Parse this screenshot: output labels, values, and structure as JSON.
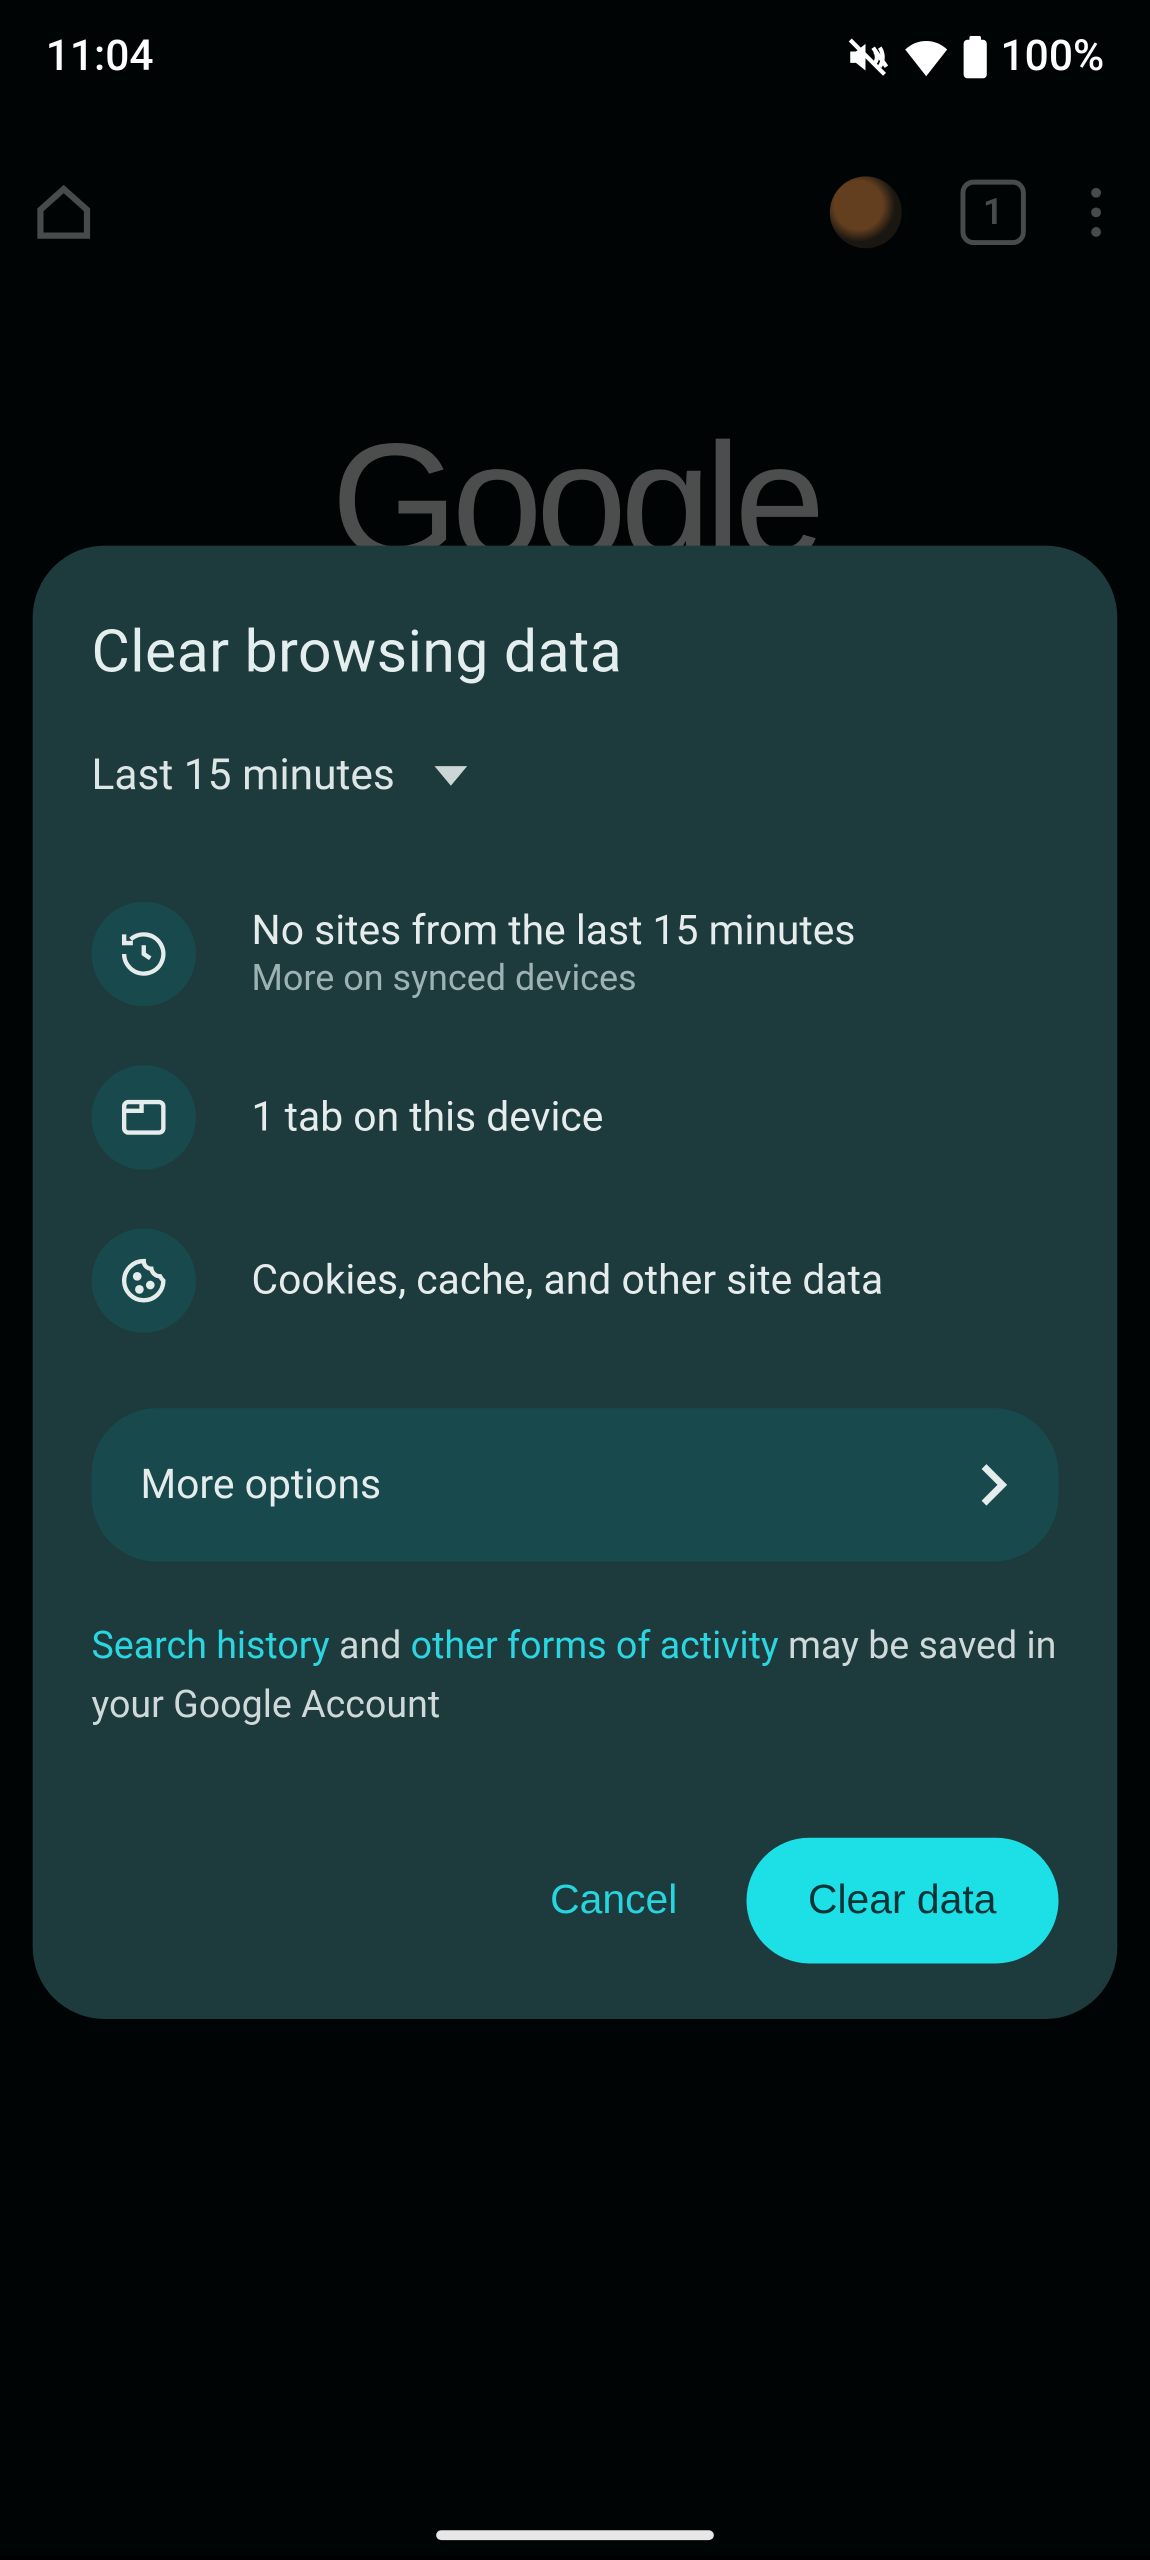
{
  "status": {
    "time": "11:04",
    "battery": "100%"
  },
  "browser": {
    "tab_count": "1",
    "background_logo": "Google"
  },
  "dialog": {
    "title": "Clear browsing data",
    "time_range": "Last 15 minutes",
    "rows": [
      {
        "title": "No sites from the last 15 minutes",
        "subtitle": "More on synced devices"
      },
      {
        "title": "1 tab on this device",
        "subtitle": ""
      },
      {
        "title": "Cookies, cache, and other site data",
        "subtitle": ""
      }
    ],
    "more_options": "More options",
    "footer": {
      "link1": "Search history",
      "text1": " and ",
      "link2": "other forms of activity",
      "text2": " may be saved in your Google Account"
    },
    "cancel": "Cancel",
    "confirm": "Clear data"
  }
}
